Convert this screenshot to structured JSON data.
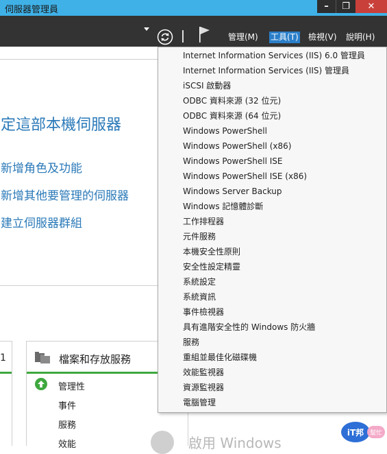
{
  "window": {
    "title": "伺服器管理員",
    "buttons": {
      "minimize": "–",
      "maximize": "❐",
      "close": "✕"
    }
  },
  "menubar": {
    "items": [
      {
        "label": "管理(M)"
      },
      {
        "label": "工具(T)",
        "active": true
      },
      {
        "label": "檢視(V)"
      },
      {
        "label": "說明(H)"
      }
    ]
  },
  "welcome": {
    "title": "定這部本機伺服器",
    "links": [
      "新增角色及功能",
      "新增其他要管理的伺服器",
      "建立伺服器群組"
    ]
  },
  "tile_left": {
    "number": "1"
  },
  "tile": {
    "title": "檔案和存放服務",
    "rows": [
      "管理性",
      "事件",
      "服務",
      "效能"
    ]
  },
  "tools_menu": {
    "items": [
      "Internet Information Services (IIS) 6.0 管理員",
      "Internet Information Services (IIS) 管理員",
      "iSCSI 啟動器",
      "ODBC 資料來源 (32 位元)",
      "ODBC 資料來源 (64 位元)",
      "Windows PowerShell",
      "Windows PowerShell (x86)",
      "Windows PowerShell ISE",
      "Windows PowerShell ISE (x86)",
      "Windows Server Backup",
      "Windows 記憶體診斷",
      "工作排程器",
      "元件服務",
      "本機安全性原則",
      "安全性設定精靈",
      "系統設定",
      "系統資訊",
      "事件檢視器",
      "具有進階安全性的 Windows 防火牆",
      "服務",
      "重組並最佳化磁碟機",
      "效能監視器",
      "資源監視器",
      "電腦管理"
    ]
  },
  "activation": {
    "text": "啟用 Windows"
  },
  "watermark": {
    "main": "iT邦",
    "sub": "幫忙"
  },
  "colors": {
    "titlebar": "#3fb1e7",
    "toolbar": "#333333",
    "menu_active": "#2b7fc9",
    "link": "#2a79b8",
    "status_green": "#3ea83e",
    "close_button": "#c9403a"
  }
}
